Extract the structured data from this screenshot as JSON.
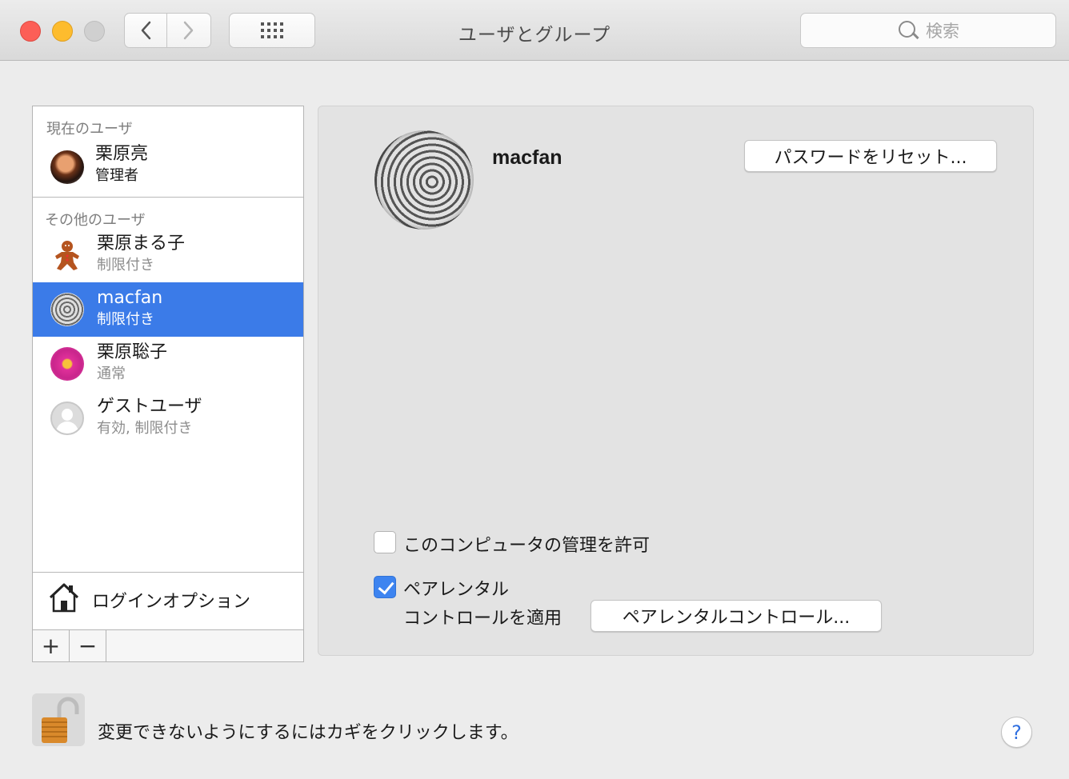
{
  "window": {
    "title": "ユーザとグループ"
  },
  "search": {
    "placeholder": "検索"
  },
  "sidebar": {
    "current_heading": "現在のユーザ",
    "current_user": {
      "name": "栗原亮",
      "role": "管理者"
    },
    "others_heading": "その他のユーザ",
    "other_users": [
      {
        "name": "栗原まる子",
        "role": "制限付き"
      },
      {
        "name": "macfan",
        "role": "制限付き"
      },
      {
        "name": "栗原聡子",
        "role": "通常"
      },
      {
        "name": "ゲストユーザ",
        "role": "有効, 制限付き"
      }
    ],
    "login_options": "ログインオプション",
    "add_label": "+",
    "remove_label": "−"
  },
  "main": {
    "user_name": "macfan",
    "reset_password_button": "パスワードをリセット...",
    "allow_admin_label": "このコンピュータの管理を許可",
    "allow_admin_checked": false,
    "parental_label_line1": "ペアレンタル",
    "parental_label_line2": "コントロールを適用",
    "parental_checked": true,
    "parental_button": "ペアレンタルコントロール..."
  },
  "footer": {
    "lock_text": "変更できないようにするにはカギをクリックします。",
    "help": "?"
  },
  "colors": {
    "selection": "#3b7be8",
    "close": "#fc5f57",
    "minimize": "#fdbc2e",
    "checkbox_checked": "#3d84f0"
  }
}
